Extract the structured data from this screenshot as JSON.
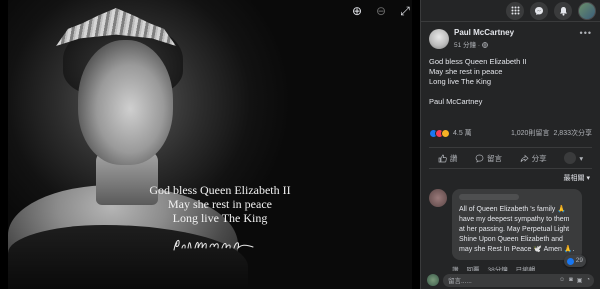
{
  "viewer": {
    "tools": [
      {
        "icon": "zoom-in-icon",
        "glyph": "⊕"
      },
      {
        "icon": "zoom-out-icon",
        "glyph": "⊖"
      },
      {
        "icon": "fullscreen-icon",
        "glyph": "⤢"
      }
    ],
    "quote_lines": [
      "God bless Queen Elizabeth II",
      "May she rest in peace",
      "Long live The King"
    ],
    "signature_text": "Paul McCartney"
  },
  "topbar": {
    "icons": [
      "menu-grid-icon",
      "messenger-icon",
      "notifications-icon",
      "account-avatar"
    ]
  },
  "post": {
    "author": "Paul McCartney",
    "time": "51 分鐘",
    "audience_icon": "public-globe-icon",
    "more": "•••",
    "body_lines": [
      "God bless Queen Elizabeth II",
      "May she rest in peace",
      "Long live The King"
    ],
    "signoff": "Paul McCartney",
    "reactions_count": "4.5 萬",
    "comments_count": "1,020則留言",
    "shares_count": "2,833次分享",
    "reaction_colors": [
      "#1877f2",
      "#f33e58",
      "#f7b125"
    ]
  },
  "actions": {
    "like": "讚",
    "comment": "留言",
    "share": "分享"
  },
  "sort_label": "最相關 ▾",
  "comment": {
    "text": "All of Queen Elizabeth 's family 🙏 have my deepest sympathy to them at her passing. May Perpetual Light Shine Upon Queen Elizabeth and may she Rest In Peace 🕊️ Amen 🙏.",
    "reaction_count": "29",
    "action_like": "讚",
    "action_reply": "回覆",
    "time": "38分鐘",
    "status": "已編輯"
  },
  "composer": {
    "placeholder": "留言......"
  }
}
